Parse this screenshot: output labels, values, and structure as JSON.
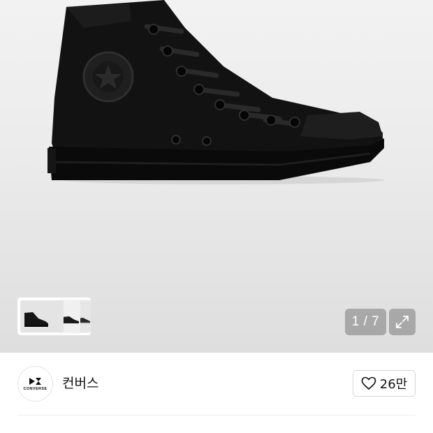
{
  "gallery": {
    "counter": "1 / 7",
    "expand_icon": "expand-arrows-icon",
    "thumbnails_next_icon": "chevron-right-icon"
  },
  "brand": {
    "logo_text": "CONVERSE",
    "name": "컨버스",
    "likes": "26만",
    "like_icon": "heart-outline-icon"
  },
  "colors": {
    "counter_bg": "#969696",
    "text": "#111111",
    "border": "#d6d6d6"
  }
}
